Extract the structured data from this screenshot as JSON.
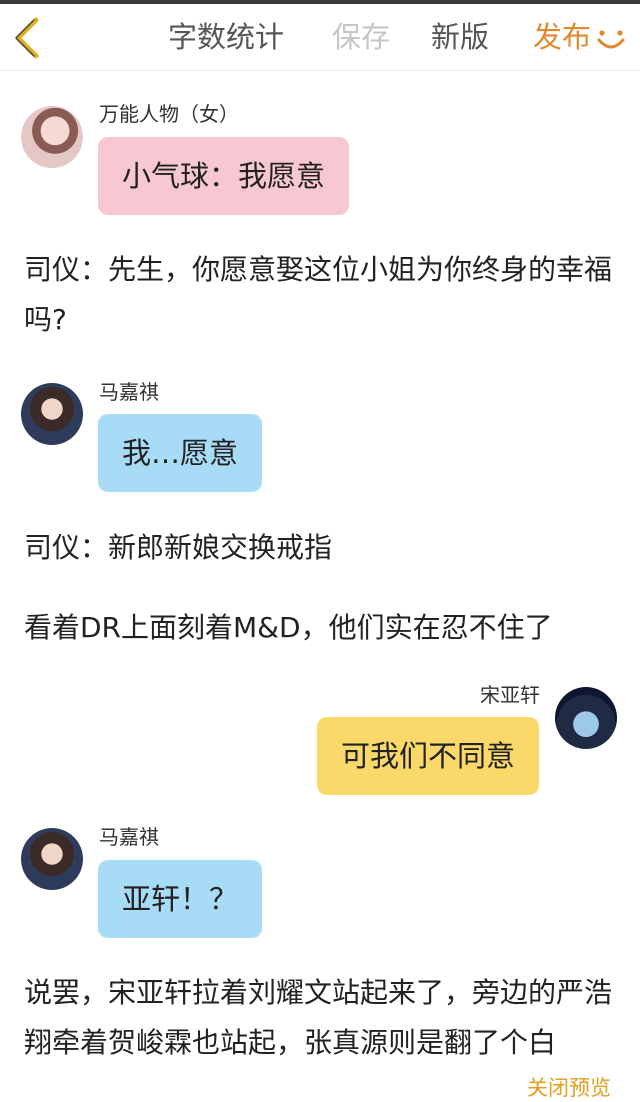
{
  "toolbar": {
    "count_label": "字数统计",
    "save_label": "保存",
    "new_version_label": "新版",
    "publish_label": "发布"
  },
  "messages": [
    {
      "speaker": "万能人物（女）",
      "text": "小气球：我愿意",
      "color": "#f8c8d2"
    },
    {
      "speaker": "马嘉祺",
      "text": "我…愿意",
      "color": "#a8dcf6"
    },
    {
      "speaker": "宋亚轩",
      "text": "可我们不同意",
      "color": "#fad96a"
    },
    {
      "speaker": "马嘉祺",
      "text": "亚轩！？",
      "color": "#a8dcf6"
    }
  ],
  "narration": [
    "司仪：先生，你愿意娶这位小姐为你终身的幸福吗?",
    "司仪：新郎新娘交换戒指",
    "看着DR上面刻着M&D，他们实在忍不住了",
    "说罢，宋亚轩拉着刘耀文站起来了，旁边的严浩翔牵着贺峻霖也站起，张真源则是翻了个白"
  ],
  "footer": {
    "close_preview_label": "关闭预览"
  },
  "colors": {
    "accent": "#e08a2e",
    "footer": "#e0a020"
  }
}
